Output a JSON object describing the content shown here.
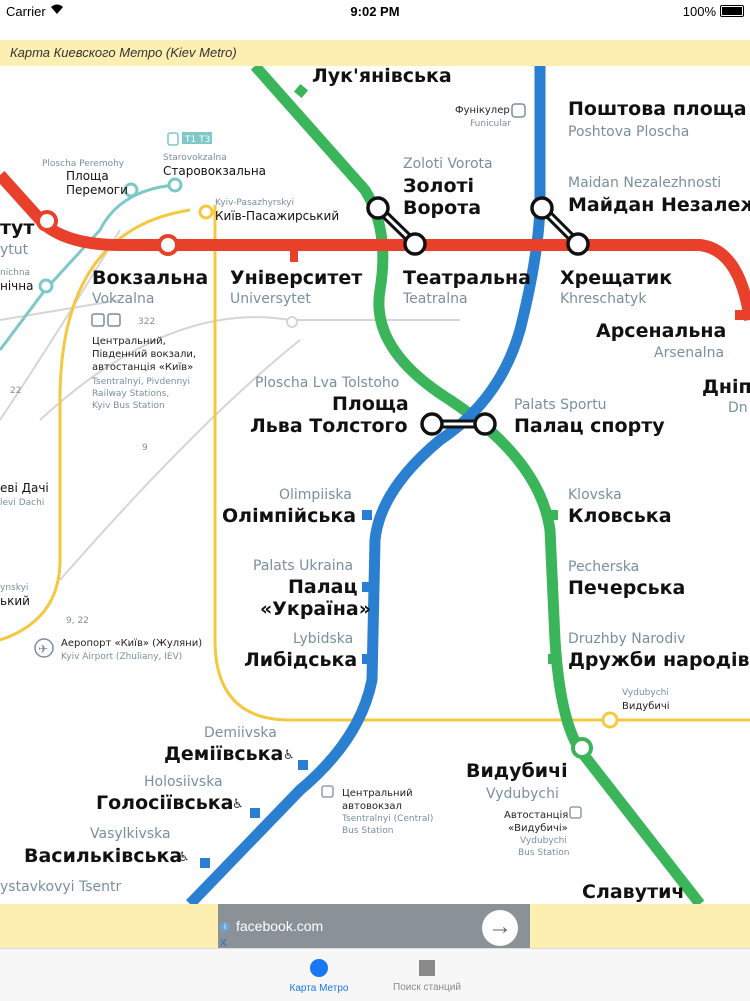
{
  "status_bar": {
    "carrier": "Carrier",
    "time": "9:02 PM",
    "battery": "100%"
  },
  "app": {
    "title": "Карта Киевского Метро (Kiev Metro)"
  },
  "colors": {
    "red_line": "#e8402a",
    "blue_line": "#2b7fd0",
    "green_line": "#3bb55a",
    "yellow_line": "#f5c842",
    "accent": "#1877f2",
    "banner": "#fdeeb1"
  },
  "map": {
    "stations": {
      "lukianivska": {
        "name": "Лук'янівська"
      },
      "poshtova": {
        "name": "Поштова площа",
        "latin": "Poshtova Ploscha"
      },
      "funicular": {
        "name": "Фунікулер",
        "latin": "Funicular"
      },
      "zoloti_vorota": {
        "latin": "Zoloti Vorota",
        "name_line1": "Золоті",
        "name_line2": "Ворота"
      },
      "maidan": {
        "latin": "Maidan Nezalezhnosti",
        "name": "Майдан Незалеж"
      },
      "starovokzalna": {
        "latin": "Starovokzalna",
        "name": "Старовокзальна",
        "badges": "T1 T3"
      },
      "ploscha_peremohy": {
        "latin": "Ploscha Peremohy",
        "name_line1": "Площа",
        "name_line2": "Перемоги"
      },
      "kyiv_pasazhyrskyi": {
        "latin": "Kyiv-Pasazhyrskyi",
        "name": "Київ-Пасажирський"
      },
      "politekhnichnyi_partial": {
        "name": "тут",
        "latin": "ytut"
      },
      "shuliavska_partial": {
        "latin": "nichna",
        "name": "нічна"
      },
      "vokzalna": {
        "name": "Вокзальна",
        "latin": "Vokzalna"
      },
      "universytet": {
        "name": "Університет",
        "latin": "Universytet"
      },
      "teatralna": {
        "name": "Театральна",
        "latin": "Teatralna"
      },
      "khreschatyk": {
        "name": "Хрещатик",
        "latin": "Khreschatyk"
      },
      "arsenalna": {
        "name": "Арсенальна",
        "latin": "Arsenalna"
      },
      "dnipro_partial": {
        "name": "Дніп",
        "latin": "Dn"
      },
      "ploscha_lva_tolstoho": {
        "latin": "Ploscha Lva Tolstoho",
        "name_line1": "Площа",
        "name_line2": "Льва Толстого"
      },
      "palats_sportu": {
        "latin": "Palats Sportu",
        "name": "Палац спорту"
      },
      "olimpiiska": {
        "latin": "Olimpiiska",
        "name": "Олімпійська"
      },
      "klovska": {
        "latin": "Klovska",
        "name": "Кловська"
      },
      "palats_ukraina": {
        "latin": "Palats Ukraina",
        "name_line1": "Палац",
        "name_line2": "«Україна»"
      },
      "pecherska": {
        "latin": "Pecherska",
        "name": "Печерська"
      },
      "lybidska": {
        "latin": "Lybidska",
        "name": "Либідська"
      },
      "druzhby_narodiv": {
        "latin": "Druzhby Narodiv",
        "name": "Дружби народів"
      },
      "vydubychi_rail": {
        "latin": "Vydubychi",
        "name": "Видубичі"
      },
      "vydubychi": {
        "name": "Видубичі",
        "latin": "Vydubychi"
      },
      "demiivska": {
        "latin": "Demiivska",
        "name": "Деміївська"
      },
      "holosiivska": {
        "latin": "Holosiivska",
        "name": "Голосіївська"
      },
      "vasylkivska": {
        "latin": "Vasylkivska",
        "name": "Васильківська"
      },
      "vystavkovyi_partial": {
        "latin": "ystavkovyi Tsentr"
      },
      "slavutych": {
        "name": "Славутич"
      },
      "dachi_partial": {
        "name": "еві Дачі",
        "latin": "levi Dachi"
      },
      "left_partial": {
        "name": "ький",
        "latin": "ynskyi"
      }
    },
    "info": {
      "vokzal_bus": "322",
      "vokzal_line1": "Центральний,",
      "vokzal_line2": "Південний вокзали,",
      "vokzal_line3": "автостанція «Київ»",
      "vokzal_lat1": "Tsentralnyi, Pivdennyi",
      "vokzal_lat2": "Railway Stations,",
      "vokzal_lat3": "Kyiv Bus Station",
      "bus_9": "9",
      "bus_9b": "9",
      "bus_22": "22",
      "bus_9_22": "9, 22",
      "airport": "Аеропорт «Київ» (Жуляни)",
      "airport_lat": "Kyiv Airport (Zhuliany, IEV)",
      "central_bus_line1": "Центральний",
      "central_bus_line2": "автовокзал",
      "central_bus_lat1": "Tsentralnyi (Central)",
      "central_bus_lat2": "Bus Station",
      "vydubychi_bus_line1": "Автостанція",
      "vydubychi_bus_line2": "«Видубичі»",
      "vydubychi_bus_lat1": "Vydubychi",
      "vydubychi_bus_lat2": "Bus Station"
    }
  },
  "ad": {
    "text": "facebook.com",
    "info_icon": "i",
    "close_icon": "X",
    "arrow": "→"
  },
  "tabs": [
    {
      "label": "Карта Метро",
      "icon": "map-icon",
      "active": true
    },
    {
      "label": "Поиск станций",
      "icon": "search-stations-icon",
      "active": false
    }
  ]
}
